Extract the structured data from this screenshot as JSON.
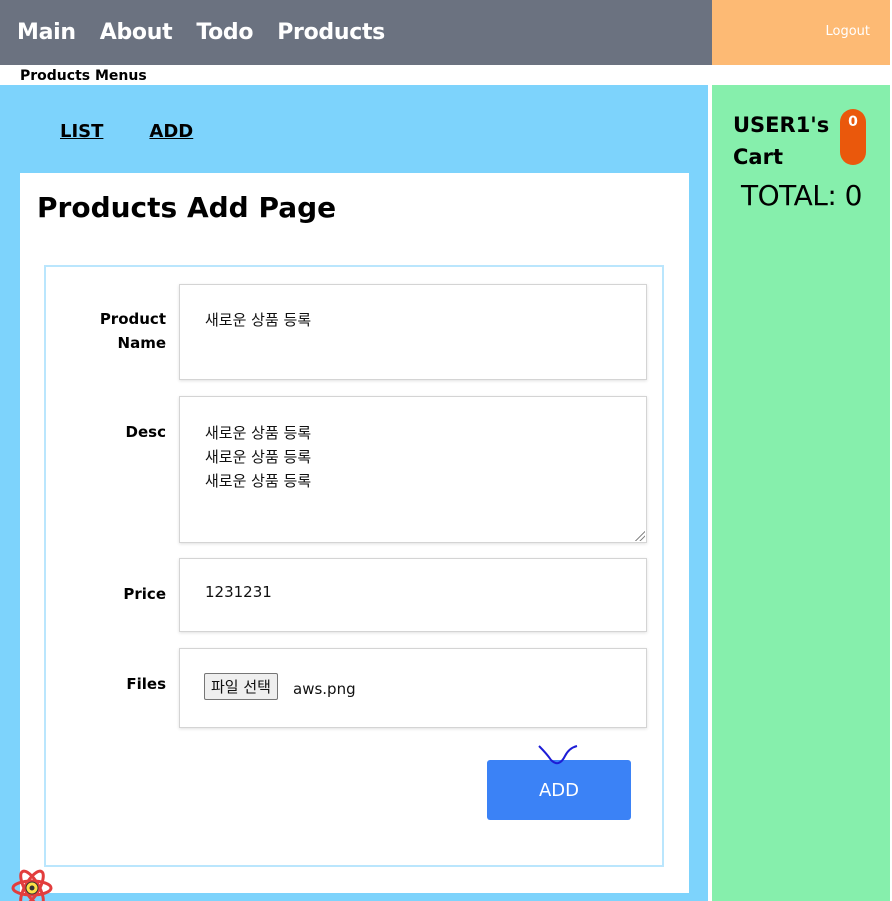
{
  "nav": {
    "links": [
      "Main",
      "About",
      "Todo",
      "Products"
    ],
    "logout": "Logout"
  },
  "submenu_title": "Products Menus",
  "tabs": [
    "LIST",
    "ADD"
  ],
  "page_title": "Products Add Page",
  "form": {
    "name_label_1": "Product",
    "name_label_2": "Name",
    "name_value": "새로운 상품 등록",
    "desc_label": "Desc",
    "desc_lines": [
      "새로운 상품 등록",
      "새로운 상품 등록",
      "새로운 상품 등록"
    ],
    "price_label": "Price",
    "price_value": "1231231",
    "files_label": "Files",
    "file_button": "파일 선택",
    "file_name": "aws.png",
    "submit": "ADD"
  },
  "cart": {
    "title": "USER1's Cart",
    "count": "0",
    "total": "TOTAL: 0"
  },
  "icons": {
    "react_logo": "react-logo-icon",
    "cursor": "hand-cursor-icon"
  },
  "colors": {
    "nav_bg": "#6b7280",
    "logout_bg": "#fdba74",
    "main_bg": "#7dd3fc",
    "cart_bg": "#86efac",
    "badge": "#ea580c",
    "button": "#3b82f6"
  }
}
